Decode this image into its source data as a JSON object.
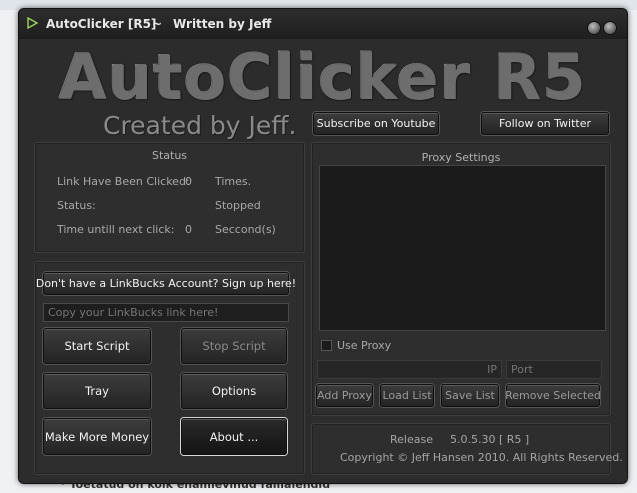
{
  "background": {
    "footer_text": "* Toetatud on kõik enamlevinud failialendid"
  },
  "window": {
    "title": "AutoClicker [R5]",
    "separator": "~",
    "author": "Written by Jeff"
  },
  "header": {
    "logo_text": "AutoClicker R5",
    "subtitle": "Created by Jeff.",
    "subscribe_label": "Subscribe on Youtube",
    "twitter_label": "Follow on Twitter"
  },
  "status": {
    "title": "Status",
    "rows": [
      {
        "label": "Link Have Been Clicked:",
        "value": "0",
        "unit": "Times."
      },
      {
        "label": "Status:",
        "value": "",
        "unit": "Stopped"
      },
      {
        "label": "Time untill next click:",
        "value": "0",
        "unit": "Seccond(s)"
      }
    ]
  },
  "controls": {
    "signup_label": "Don't have a LinkBucks Account? Sign up here!",
    "link_placeholder": "Copy your LinkBucks link here!",
    "start_label": "Start Script",
    "stop_label": "Stop Script",
    "tray_label": "Tray",
    "options_label": "Options",
    "money_label": "Make More Money",
    "about_label": "About ..."
  },
  "proxy": {
    "title": "Proxy Settings",
    "use_proxy_label": "Use Proxy",
    "ip_placeholder": "IP",
    "port_placeholder": "Port",
    "add_label": "Add Proxy",
    "load_label": "Load List",
    "save_label": "Save List",
    "remove_label": "Remove Selected"
  },
  "release": {
    "label": "Release",
    "version": "5.0.5.30 [ R5 ]",
    "copyright": "Copyright © Jeff Hansen 2010. All Rights Reserved."
  }
}
